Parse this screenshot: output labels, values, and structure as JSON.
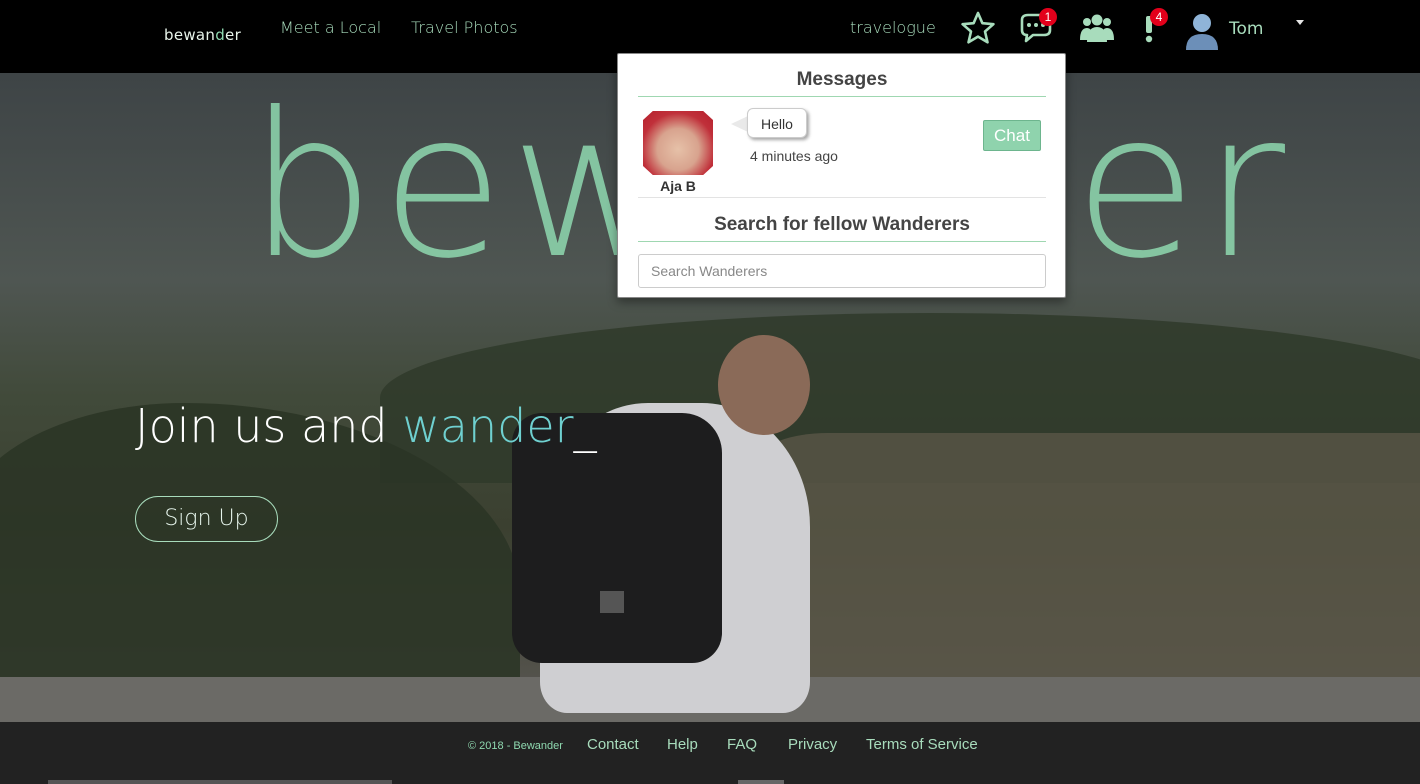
{
  "navbar": {
    "brand_prefix": "bewan",
    "brand_accent": "d",
    "brand_suffix": "er",
    "links": [
      "Meet a Local",
      "Travel Photos"
    ],
    "travelogue": "travelogue",
    "chat_badge": "1",
    "alert_badge": "4",
    "user_name": "Tom",
    "icons": [
      "star-icon",
      "chat-bubbles-icon",
      "users-icon",
      "exclamation-icon",
      "user-avatar-icon",
      "caret-down-icon"
    ]
  },
  "hero": {
    "big_title": "bewander",
    "tagline_prefix": "Join us and ",
    "tagline_word": "wander",
    "tagline_cursor": "_",
    "signup_label": "Sign Up"
  },
  "messages_panel": {
    "heading": "Messages",
    "messages": [
      {
        "sender": "Aja B",
        "text": "Hello",
        "time": "4 minutes ago",
        "action": "Chat"
      }
    ],
    "search_heading": "Search for fellow Wanderers",
    "search_placeholder": "Search Wanderers"
  },
  "footer": {
    "copyright": "© 2018 - Bewander",
    "links": [
      "Contact",
      "Help",
      "FAQ",
      "Privacy",
      "Terms of Service"
    ]
  },
  "colors": {
    "accent_green": "#8fd9b0",
    "accent_teal": "#6fd0d0",
    "badge_red": "#e3001b",
    "navbar_bg": "#000000",
    "footer_bg": "#222222"
  }
}
